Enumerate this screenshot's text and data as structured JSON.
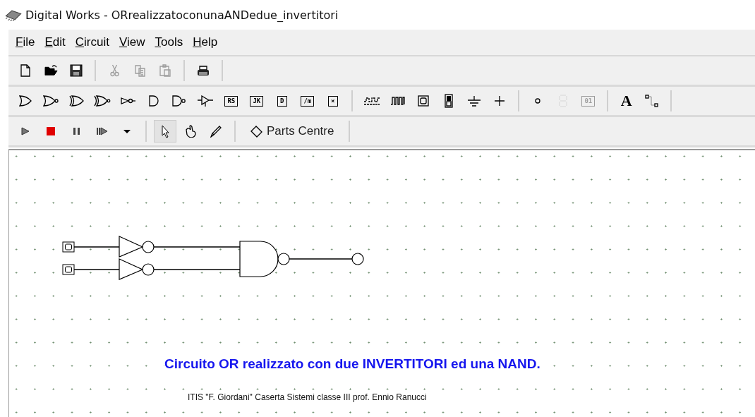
{
  "window": {
    "title": "Digital Works - ORrealizzatoconunaANDedue_invertitori"
  },
  "menu": [
    {
      "label": "File"
    },
    {
      "label": "Edit"
    },
    {
      "label": "Circuit"
    },
    {
      "label": "View"
    },
    {
      "label": "Tools"
    },
    {
      "label": "Help"
    }
  ],
  "toolbars": [
    {
      "items": [
        {
          "kind": "icon",
          "disabled": false
        },
        {
          "kind": "icon",
          "disabled": false
        },
        {
          "kind": "icon",
          "disabled": false
        },
        {
          "kind": "separator"
        },
        {
          "kind": "icon",
          "disabled": true
        },
        {
          "kind": "icon",
          "disabled": true
        },
        {
          "kind": "icon",
          "disabled": true
        },
        {
          "kind": "separator"
        },
        {
          "kind": "icon",
          "disabled": false
        },
        {
          "kind": "separator"
        }
      ]
    },
    {
      "items": [
        {
          "kind": "icon",
          "disabled": false
        },
        {
          "kind": "icon",
          "disabled": false
        },
        {
          "kind": "icon",
          "disabled": false
        },
        {
          "kind": "icon",
          "disabled": false
        },
        {
          "kind": "icon",
          "disabled": false
        },
        {
          "kind": "icon",
          "disabled": false
        },
        {
          "kind": "icon",
          "disabled": false
        },
        {
          "kind": "icon",
          "disabled": false
        },
        {
          "kind": "boxed",
          "label": "RS",
          "disabled": false
        },
        {
          "kind": "boxed",
          "label": "JK",
          "disabled": false
        },
        {
          "kind": "boxed",
          "label": "D",
          "disabled": false
        },
        {
          "kind": "boxed",
          "label": "/m",
          "disabled": false
        },
        {
          "kind": "boxed",
          "label": "×",
          "disabled": false
        },
        {
          "kind": "separator"
        },
        {
          "kind": "icon",
          "disabled": false
        },
        {
          "kind": "icon",
          "disabled": false
        },
        {
          "kind": "icon",
          "disabled": false
        },
        {
          "kind": "icon",
          "disabled": false
        },
        {
          "kind": "icon",
          "disabled": false
        },
        {
          "kind": "icon",
          "disabled": false
        },
        {
          "kind": "separator"
        },
        {
          "kind": "icon",
          "disabled": false
        },
        {
          "kind": "icon",
          "disabled": true
        },
        {
          "kind": "boxed",
          "label": "01",
          "disabled": true
        },
        {
          "kind": "separator"
        },
        {
          "kind": "letter",
          "label": "A",
          "disabled": false
        },
        {
          "kind": "icon",
          "disabled": false
        },
        {
          "kind": "separator"
        }
      ]
    },
    {
      "items": [
        {
          "kind": "icon",
          "disabled": false
        },
        {
          "kind": "icon",
          "disabled": false
        },
        {
          "kind": "icon",
          "disabled": false
        },
        {
          "kind": "icon",
          "disabled": false
        },
        {
          "kind": "icon",
          "disabled": false
        },
        {
          "kind": "separator"
        },
        {
          "kind": "tool",
          "selected": true
        },
        {
          "kind": "tool",
          "selected": false
        },
        {
          "kind": "tool",
          "selected": false
        },
        {
          "kind": "separator"
        },
        {
          "kind": "text",
          "label": "Parts Centre"
        },
        {
          "kind": "separator"
        }
      ]
    }
  ],
  "canvas": {
    "inputs": [
      {
        "on": false
      },
      {
        "on": false
      }
    ],
    "caption": "Circuito OR realizzato con due INVERTITORI ed una NAND.",
    "credits": "ITIS \"F. Giordani\" Caserta Sistemi classe III prof. Ennio Ranucci"
  }
}
